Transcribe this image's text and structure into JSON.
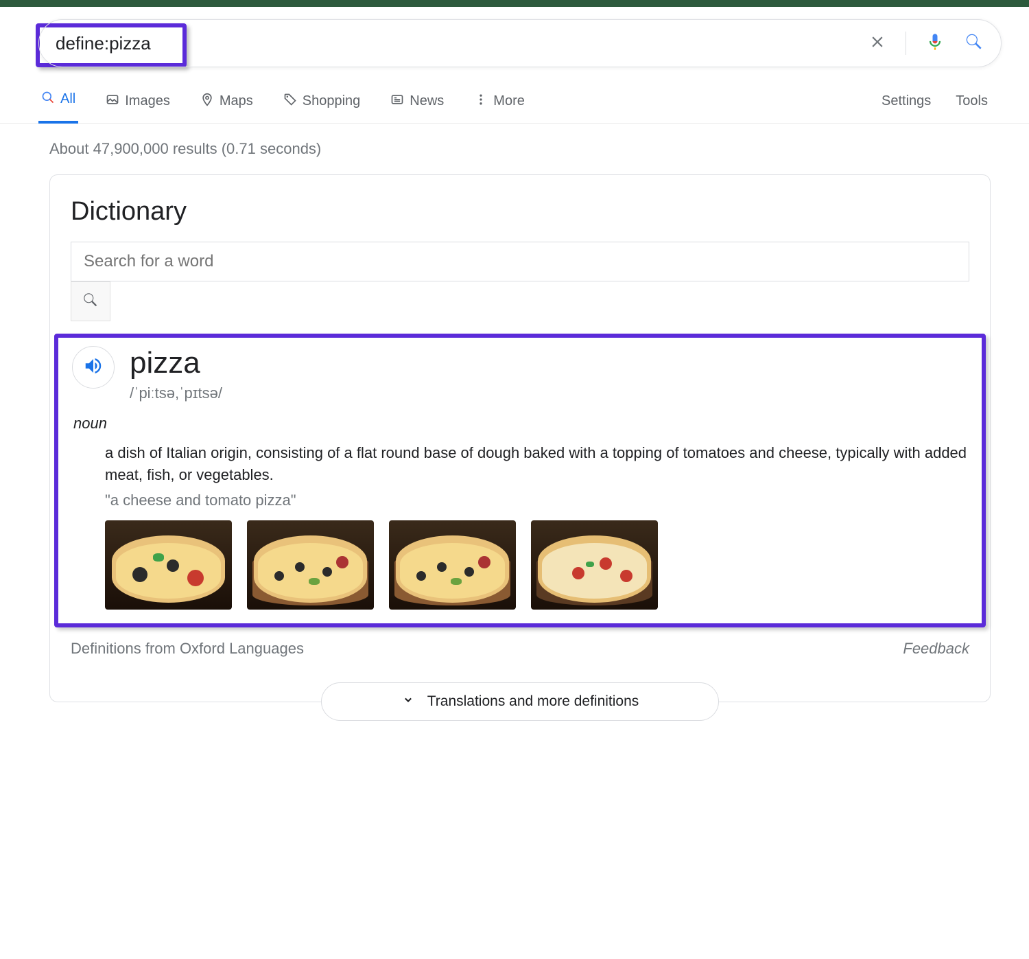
{
  "search": {
    "query": "define:pizza",
    "highlight_color": "#5b2bd9"
  },
  "tabs": {
    "all": "All",
    "images": "Images",
    "maps": "Maps",
    "shopping": "Shopping",
    "news": "News",
    "more": "More"
  },
  "right_links": {
    "settings": "Settings",
    "tools": "Tools"
  },
  "result_stats": "About 47,900,000 results (0.71 seconds)",
  "dictionary": {
    "title": "Dictionary",
    "search_placeholder": "Search for a word",
    "word": "pizza",
    "pronunciation": "/ˈpiːtsə,ˈpɪtsə/",
    "part_of_speech": "noun",
    "definition": "a dish of Italian origin, consisting of a flat round base of dough baked with a topping of tomatoes and cheese, typically with added meat, fish, or vegetables.",
    "example": "\"a cheese and tomato pizza\"",
    "source": "Definitions from Oxford Languages",
    "feedback": "Feedback",
    "expand": "Translations and more definitions",
    "image_alts": [
      "pizza-thumb-1",
      "pizza-thumb-2",
      "pizza-thumb-3",
      "pizza-thumb-4"
    ]
  }
}
